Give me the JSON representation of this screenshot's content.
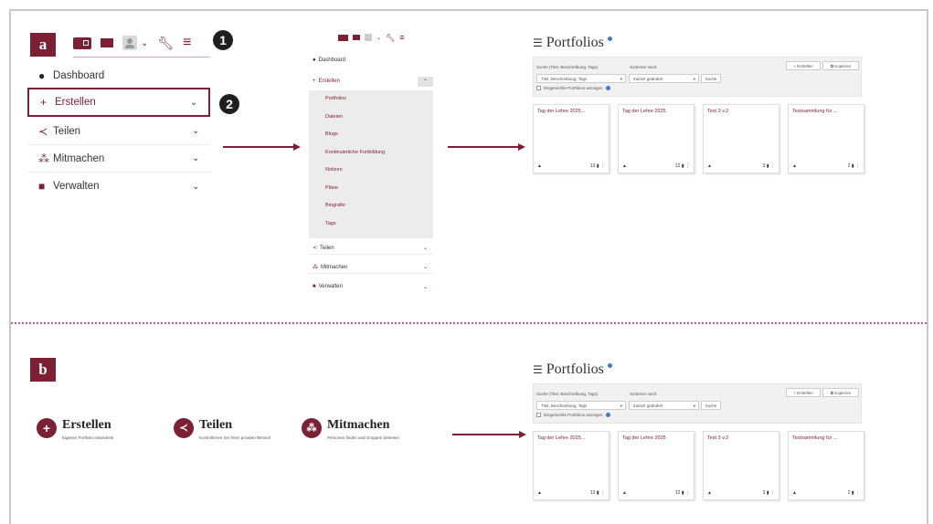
{
  "panels": {
    "a": "a",
    "b": "b"
  },
  "callouts": {
    "one": "1",
    "two": "2"
  },
  "nav": {
    "items": [
      {
        "icon": "dashboard-icon",
        "label": "Dashboard"
      },
      {
        "icon": "plus-icon",
        "label": "Erstellen"
      },
      {
        "icon": "share-icon",
        "label": "Teilen"
      },
      {
        "icon": "group-icon",
        "label": "Mitmachen"
      },
      {
        "icon": "briefcase-icon",
        "label": "Verwalten"
      }
    ]
  },
  "small_nav": {
    "items": [
      {
        "label": "Dashboard"
      },
      {
        "label": "Erstellen"
      },
      {
        "label": "Teilen"
      },
      {
        "label": "Mitmachen"
      },
      {
        "label": "Verwalten"
      }
    ],
    "submenu": [
      "Portfolios",
      "Dateien",
      "Blogs",
      "Kontinuierliche Fortbildung",
      "Notizen",
      "Pläne",
      "Biografie",
      "Tags"
    ]
  },
  "portfolio": {
    "title": "Portfolios",
    "search_label": "Suche (Titel, Beschreibung, Tags)",
    "search_value": "Titel, Beschreibung, Tags",
    "sort_label": "Sortieren nach:",
    "sort_value": "Zuletzt geändert",
    "search_button": "Suche",
    "checkbox_label": "Eingereichte Portfolios anzeigen",
    "create_button": "+ Erstellen",
    "copy_button": "Kopieren",
    "cards": [
      {
        "title": "Tag der Lehre 2025...",
        "count": "13"
      },
      {
        "title": "Tag der Lehre 2025",
        "count": "12"
      },
      {
        "title": "Test 3 v.2",
        "count": "3"
      },
      {
        "title": "Testsammlung für ...",
        "count": "2"
      }
    ]
  },
  "actions": [
    {
      "title": "Erstellen",
      "desc": "Eigenes Portfolio entwickeln"
    },
    {
      "title": "Teilen",
      "desc": "Kontrollieren Sie Ihren privaten Bereich"
    },
    {
      "title": "Mitmachen",
      "desc": "Personen finden und Gruppen beitreten"
    }
  ]
}
